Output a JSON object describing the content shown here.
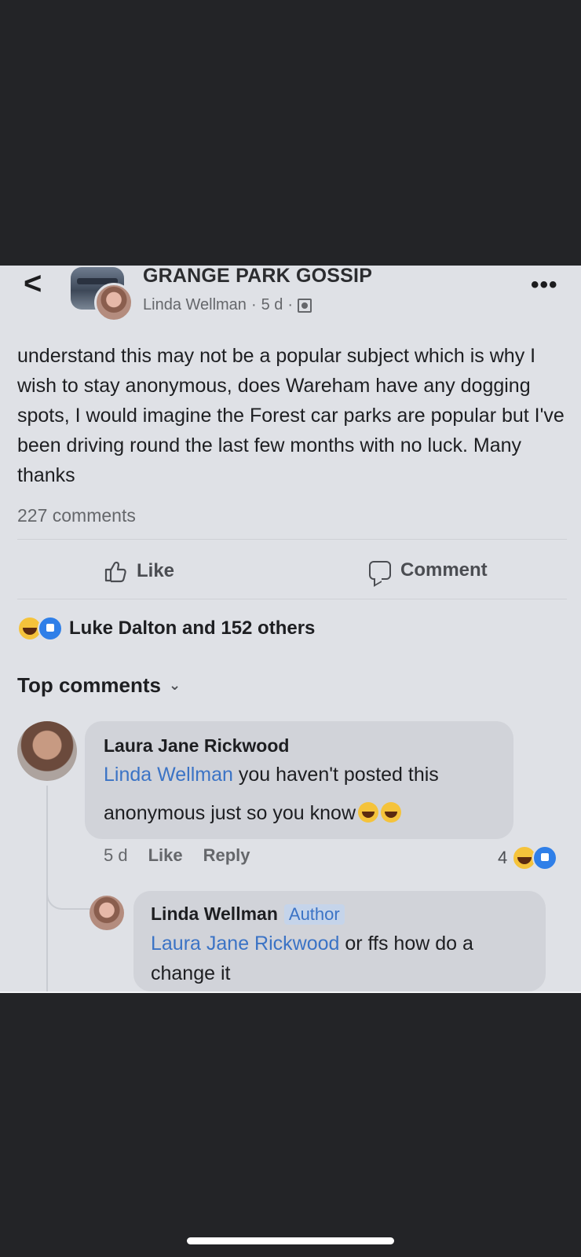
{
  "header": {
    "group_name": "GRANGE PARK GOSSIP",
    "author": "Linda Wellman",
    "time": "5 d",
    "separator": "·",
    "more_label": "•••",
    "back_label": "<"
  },
  "post": {
    "body": "understand this may not be a popular subject which is why I wish to stay anonymous, does Wareham have any dogging spots, I would imagine the Forest car parks are popular but I've been driving round the last few months with no luck. Many thanks",
    "comment_count": "227 comments"
  },
  "actions": {
    "like_label": "Like",
    "comment_label": "Comment"
  },
  "reactions": {
    "summary": "Luke Dalton and 152 others",
    "icons": [
      "haha-emoji",
      "like-emoji"
    ]
  },
  "comments_section": {
    "title": "Top comments",
    "chevron": "⌄"
  },
  "comments": [
    {
      "author": "Laura Jane Rickwood",
      "mention": "Linda Wellman",
      "text_line1": " you haven't posted this",
      "text_line2": "anonymous just so you know",
      "time": "5 d",
      "like_label": "Like",
      "reply_label": "Reply",
      "reaction_count": "4"
    },
    {
      "author": "Linda Wellman",
      "badge": "Author",
      "mention": "Laura Jane Rickwood",
      "text_line1": " or ffs how do a",
      "text_line2": "change it"
    }
  ],
  "colors": {
    "screenshot_bg": "#dfe1e6",
    "phone_bg": "#232427",
    "mention": "#3b73c5",
    "bubble": "#d1d3d9"
  }
}
